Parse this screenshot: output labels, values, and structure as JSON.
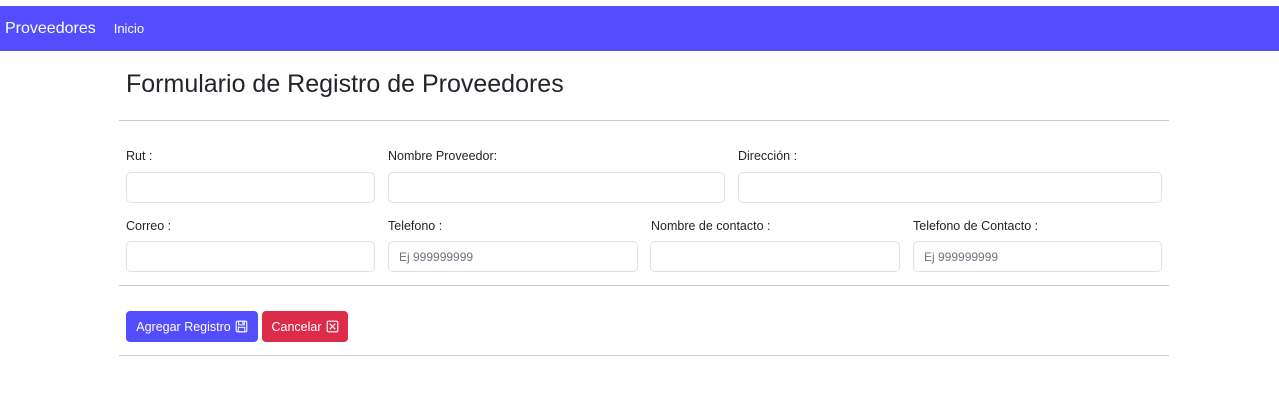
{
  "navbar": {
    "brand": "Proveedores",
    "links": [
      "Inicio"
    ]
  },
  "page_title": "Formulario de Registro de Proveedores",
  "form": {
    "rut": {
      "label": "Rut :",
      "value": "",
      "placeholder": ""
    },
    "nombre_proveedor": {
      "label": "Nombre Proveedor:",
      "value": "",
      "placeholder": ""
    },
    "direccion": {
      "label": "Dirección :",
      "value": "",
      "placeholder": ""
    },
    "correo": {
      "label": "Correo :",
      "value": "",
      "placeholder": ""
    },
    "telefono": {
      "label": "Telefono :",
      "value": "",
      "placeholder": "Ej 999999999"
    },
    "nombre_contacto": {
      "label": "Nombre de contacto :",
      "value": "",
      "placeholder": ""
    },
    "telefono_contacto": {
      "label": "Telefono de Contacto :",
      "value": "",
      "placeholder": "Ej 999999999"
    }
  },
  "actions": {
    "submit_label": "Agregar Registro",
    "submit_icon": "floppy-disk-icon",
    "cancel_label": "Cancelar",
    "cancel_icon": "close-box-icon"
  },
  "colors": {
    "navbar": "#544dff",
    "primary": "#544dff",
    "danger": "#dc2c4a"
  }
}
